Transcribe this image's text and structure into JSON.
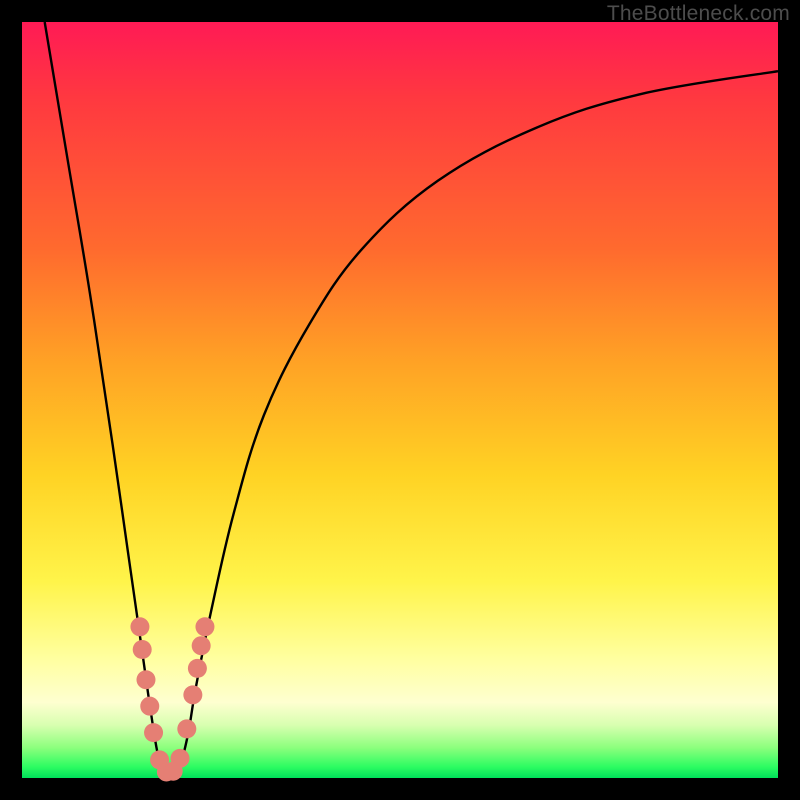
{
  "watermark": "TheBottleneck.com",
  "colors": {
    "bead": "#e57f74",
    "curve": "#000000",
    "frame": "#000000"
  },
  "chart_data": {
    "type": "line",
    "title": "",
    "xlabel": "",
    "ylabel": "",
    "xlim": [
      0,
      100
    ],
    "ylim": [
      0,
      100
    ],
    "grid": false,
    "note": "Axes are unlabeled percentages; x≈0–100 normalized, y≈0 at bottom (best / green) to 100 at top (worst / red). Curve is a V-shaped bottleneck profile with minimum near x≈19.",
    "series": [
      {
        "name": "bottleneck-curve",
        "x": [
          3,
          6,
          9,
          12,
          14,
          16,
          17,
          18,
          19,
          20,
          21,
          22,
          23,
          25,
          28,
          32,
          38,
          45,
          55,
          68,
          82,
          100
        ],
        "y": [
          100,
          82,
          64,
          44,
          30,
          16,
          9,
          3,
          0.7,
          0.6,
          2,
          6,
          12,
          22,
          35,
          48,
          60,
          70,
          79,
          86,
          90.5,
          93.5
        ]
      }
    ],
    "markers": {
      "name": "highlight-beads",
      "note": "Clustered markers on both walls of the V near its base",
      "points": [
        {
          "x": 15.6,
          "y": 20
        },
        {
          "x": 15.9,
          "y": 17
        },
        {
          "x": 16.4,
          "y": 13
        },
        {
          "x": 16.9,
          "y": 9.5
        },
        {
          "x": 17.4,
          "y": 6
        },
        {
          "x": 18.2,
          "y": 2.4
        },
        {
          "x": 19.1,
          "y": 0.8
        },
        {
          "x": 20.0,
          "y": 0.9
        },
        {
          "x": 20.9,
          "y": 2.6
        },
        {
          "x": 21.8,
          "y": 6.5
        },
        {
          "x": 22.6,
          "y": 11
        },
        {
          "x": 23.2,
          "y": 14.5
        },
        {
          "x": 23.7,
          "y": 17.5
        },
        {
          "x": 24.2,
          "y": 20
        }
      ]
    }
  }
}
